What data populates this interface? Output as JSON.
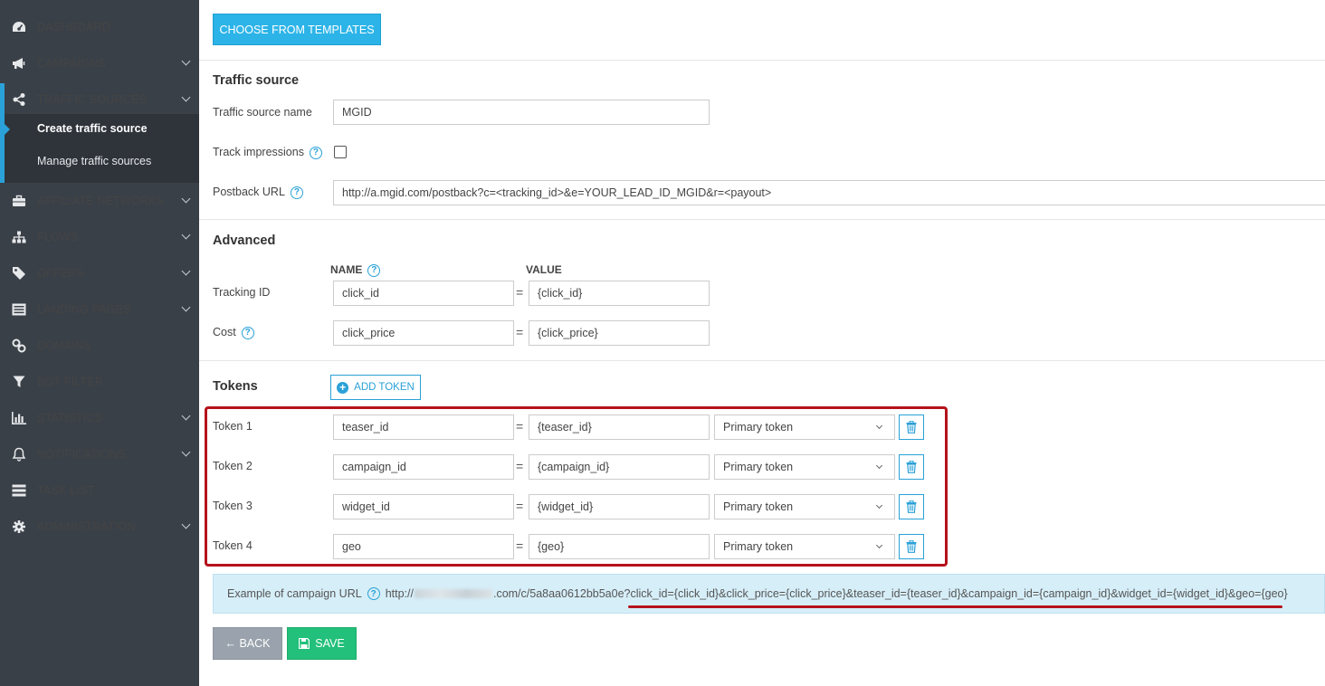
{
  "sidebar": {
    "items": [
      {
        "label": "DASHBOARD",
        "icon": "dashboard-icon"
      },
      {
        "label": "CAMPAIGNS",
        "icon": "megaphone-icon"
      },
      {
        "label": "TRAFFIC SOURCES",
        "icon": "share-icon"
      },
      {
        "label": "AFFILIATE NETWORKS",
        "icon": "briefcase-icon"
      },
      {
        "label": "FLOWS",
        "icon": "sitemap-icon"
      },
      {
        "label": "OFFERS",
        "icon": "tags-icon"
      },
      {
        "label": "LANDING PAGES",
        "icon": "list-alt-icon"
      },
      {
        "label": "DOMAINS",
        "icon": "link-icon"
      },
      {
        "label": "BOT FILTER",
        "icon": "filter-icon"
      },
      {
        "label": "STATISTICS",
        "icon": "bar-chart-icon"
      },
      {
        "label": "NOTIFICATIONS",
        "icon": "bell-icon"
      },
      {
        "label": "TASK LIST",
        "icon": "tasks-icon"
      },
      {
        "label": "ADMINISTRATION",
        "icon": "cog-icon"
      }
    ],
    "submenu": [
      "Create traffic source",
      "Manage traffic sources"
    ],
    "accent_color": "#2aa1d8"
  },
  "main": {
    "templates_button": "CHOOSE FROM TEMPLATES",
    "traffic_source": {
      "title": "Traffic source",
      "name_label": "Traffic source name",
      "name_value": "MGID",
      "track_impressions_label": "Track impressions",
      "track_impressions_checked": false,
      "postback_label": "Postback URL",
      "postback_value": "http://a.mgid.com/postback?c=<tracking_id>&e=YOUR_LEAD_ID_MGID&r=<payout>"
    },
    "advanced": {
      "title": "Advanced",
      "name_header": "NAME",
      "value_header": "VALUE",
      "rows": [
        {
          "label": "Tracking ID",
          "name": "click_id",
          "value": "{click_id}"
        },
        {
          "label": "Cost",
          "name": "click_price",
          "value": "{click_price}"
        }
      ]
    },
    "tokens": {
      "title": "Tokens",
      "add_label": "ADD TOKEN",
      "rows": [
        {
          "label": "Token 1",
          "name": "teaser_id",
          "value": "{teaser_id}",
          "type": "Primary token"
        },
        {
          "label": "Token 2",
          "name": "campaign_id",
          "value": "{campaign_id}",
          "type": "Primary token"
        },
        {
          "label": "Token 3",
          "name": "widget_id",
          "value": "{widget_id}",
          "type": "Primary token"
        },
        {
          "label": "Token 4",
          "name": "geo",
          "value": "{geo}",
          "type": "Primary token"
        }
      ]
    },
    "example": {
      "label": "Example of campaign URL",
      "url_prefix": "http://",
      "url_suffix": ".com/c/5a8aa0612bb5a0e?",
      "url_params": "click_id={click_id}&click_price={click_price}&teaser_id={teaser_id}&campaign_id={campaign_id}&widget_id={widget_id}&geo={geo}"
    },
    "back_label": "← BACK",
    "save_label": "SAVE",
    "highlight_color": "#b5121b"
  }
}
